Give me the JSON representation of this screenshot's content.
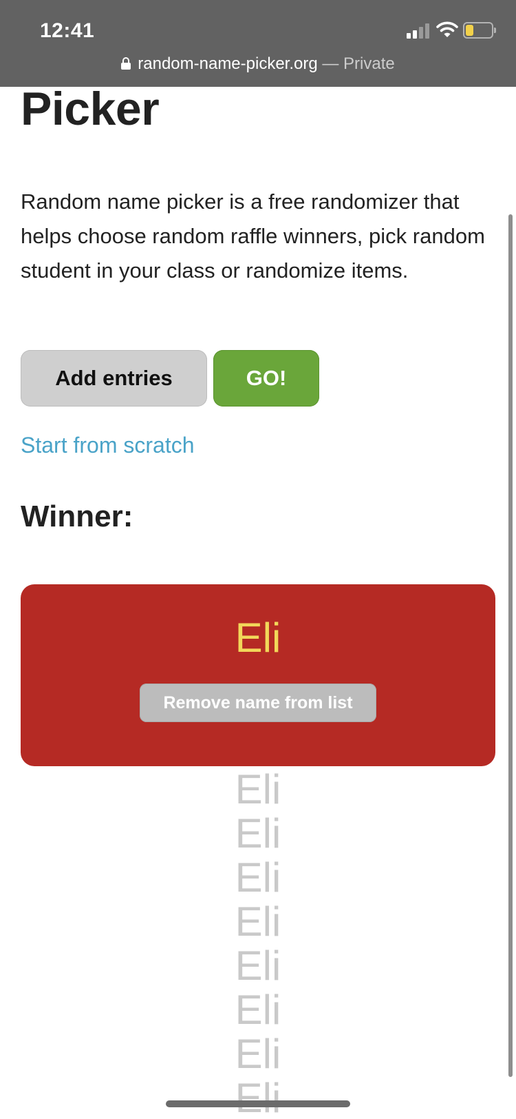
{
  "status_bar": {
    "time": "12:41",
    "icons": [
      "signal-icon",
      "wifi-icon",
      "battery-icon"
    ],
    "battery_level": 0.3,
    "battery_color": "#f2d14a"
  },
  "address_bar": {
    "icon": "lock-icon",
    "url": "random-name-picker.org",
    "separator": "—",
    "mode": "Private"
  },
  "page": {
    "title": "Random Name Picker",
    "description": "Random name picker is a free randomizer that helps choose random raffle winners, pick random student in your class or randomize items.",
    "buttons": {
      "add_entries": "Add entries",
      "go": "GO!"
    },
    "start_link": "Start from scratch",
    "winner_label": "Winner:",
    "winner": {
      "name": "Eli",
      "remove_button": "Remove name from list"
    },
    "name_list": [
      "Eli",
      "Eli",
      "Eli",
      "Eli",
      "Eli",
      "Eli",
      "Eli",
      "Eli"
    ]
  },
  "colors": {
    "go_button": "#6aa63a",
    "winner_box": "#b52a24",
    "winner_name": "#f2d75a",
    "link": "#4aa3c8"
  }
}
